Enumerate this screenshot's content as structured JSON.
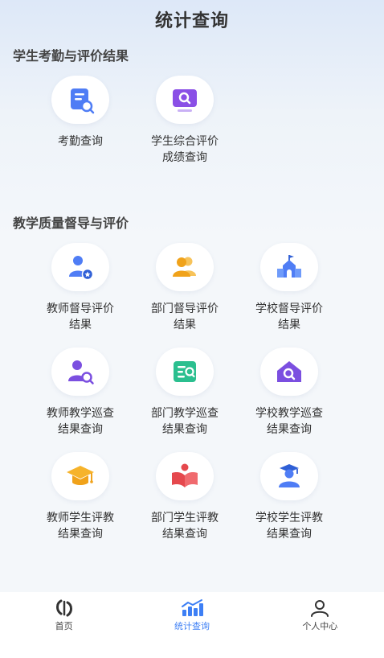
{
  "header": {
    "title": "统计查询"
  },
  "section1": {
    "title": "学生考勤与评价结果",
    "items": [
      {
        "label": "考勤查询"
      },
      {
        "label": "学生综合评价成绩查询"
      }
    ]
  },
  "section2": {
    "title": "教学质量督导与评价",
    "items": [
      {
        "label": "教师督导评价结果"
      },
      {
        "label": "部门督导评价结果"
      },
      {
        "label": "学校督导评价结果"
      },
      {
        "label": "教师教学巡查结果查询"
      },
      {
        "label": "部门教学巡查结果查询"
      },
      {
        "label": "学校教学巡查结果查询"
      },
      {
        "label": "教师学生评教结果查询"
      },
      {
        "label": "部门学生评教结果查询"
      },
      {
        "label": "学校学生评教结果查询"
      }
    ]
  },
  "tabbar": {
    "tabs": [
      {
        "label": "首页",
        "icon": "home-logo-icon"
      },
      {
        "label": "统计查询",
        "icon": "statistics-icon"
      },
      {
        "label": "个人中心",
        "icon": "user-icon"
      }
    ],
    "active": "统计查询"
  },
  "colors": {
    "accent": "#3d7ff5",
    "purple": "#7b4fe0",
    "blue": "#3b82f6",
    "orange": "#f6b32b",
    "green": "#2bbf8f",
    "red": "#e5484d"
  }
}
